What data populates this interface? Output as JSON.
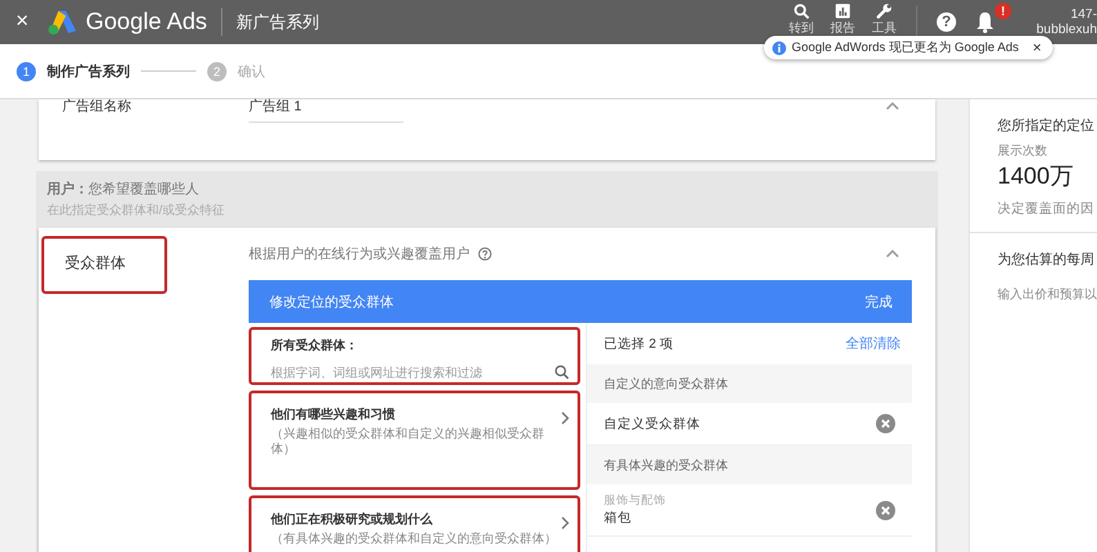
{
  "header": {
    "close": "×",
    "product": "Google Ads",
    "page_title": "新广告系列",
    "tools": [
      {
        "kind": "search",
        "label": "转到"
      },
      {
        "kind": "reports",
        "label": "报告"
      },
      {
        "kind": "tools",
        "label": "工具"
      }
    ],
    "help": "?",
    "notification_badge": "!",
    "account_id": "147-",
    "account_name": "bubblexuh"
  },
  "notice": {
    "text": "Google AdWords 现已更名为 Google Ads",
    "close": "×"
  },
  "steps": [
    {
      "number": "1",
      "label": "制作广告系列",
      "selected": true
    },
    {
      "number": "2",
      "label": "确认",
      "selected": false
    }
  ],
  "ad_group": {
    "label": "广告组名称",
    "value": "广告组 1"
  },
  "users_section": {
    "title": "**用户：**您希望覆盖哪些人",
    "subtitle": "在此指定受众群体和/或受众特征"
  },
  "audiences": {
    "label": "受众群体",
    "label_highlighted": true,
    "description": "根据用户的在线行为或兴趣覆盖用户",
    "editor_title": "修改定位的受众群体",
    "done": "完成",
    "browse_title": "所有受众群体：",
    "browse_highlighted": true,
    "search_placeholder": "根据字词、词组或网址进行搜索和过滤",
    "categories": [
      {
        "title": "他们有哪些兴趣和习惯",
        "subtitle": "（兴趣相似的受众群体和自定义的兴趣相似受众群体）",
        "highlighted": true
      },
      {
        "title": "他们正在积极研究或规划什么",
        "subtitle": "（有具体兴趣的受众群体和自定义的意向受众群体）",
        "highlighted": true
      }
    ],
    "selected_summary": "已选择 2 项",
    "clear_all": "全部清除",
    "selected_groups": [
      {
        "heading": "自定义的意向受众群体",
        "items": [
          {
            "label": "自定义受众群体"
          }
        ]
      },
      {
        "heading": "有具体兴趣的受众群体",
        "items": [
          {
            "category": "服饰与配饰",
            "label": "箱包"
          }
        ]
      }
    ]
  },
  "sidebar": {
    "reach_title": "您所指定的定位",
    "metric_label": "展示次数",
    "metric_value": "1400万",
    "reach_note": "决定覆盖面的因",
    "weekly_title": "为您估算的每周",
    "weekly_note": "输入出价和预算以"
  }
}
